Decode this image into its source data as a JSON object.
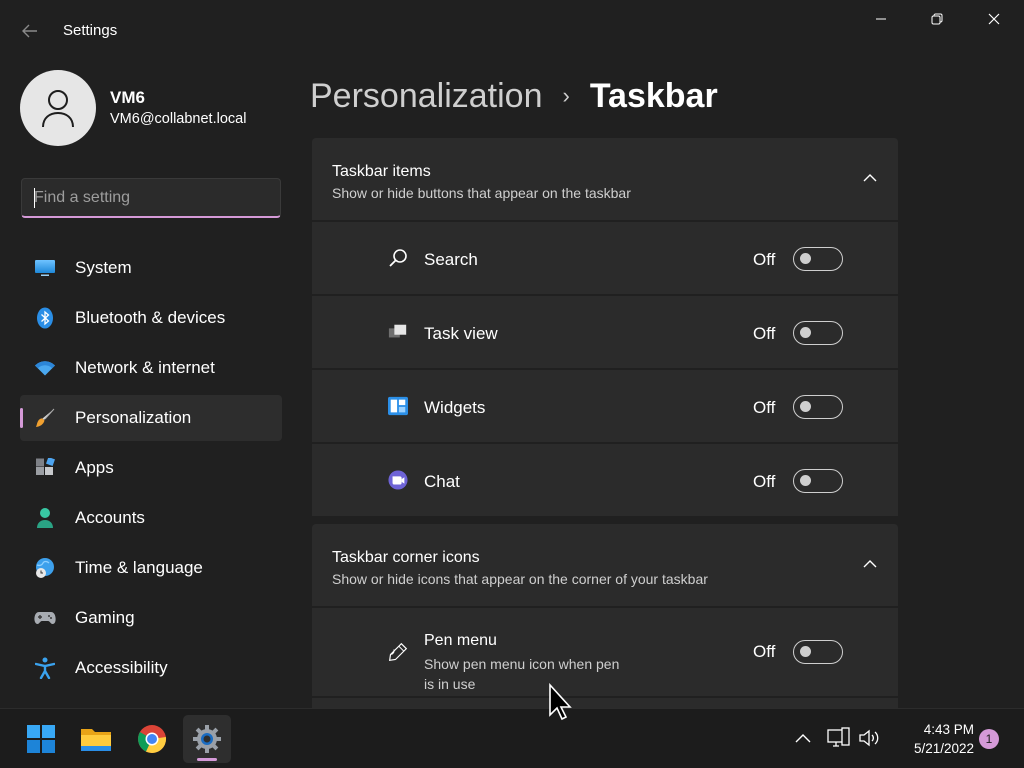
{
  "window": {
    "title": "Settings",
    "back_icon": "back-arrow-icon",
    "controls": [
      "minimize",
      "maximize",
      "close"
    ]
  },
  "user": {
    "name": "VM6",
    "email": "VM6@collabnet.local"
  },
  "search": {
    "placeholder": "Find a setting",
    "value": ""
  },
  "sidebar": {
    "items": [
      {
        "label": "System",
        "icon": "system-icon",
        "active": false
      },
      {
        "label": "Bluetooth & devices",
        "icon": "bluetooth-icon",
        "active": false
      },
      {
        "label": "Network & internet",
        "icon": "wifi-icon",
        "active": false
      },
      {
        "label": "Personalization",
        "icon": "paintbrush-icon",
        "active": true
      },
      {
        "label": "Apps",
        "icon": "apps-icon",
        "active": false
      },
      {
        "label": "Accounts",
        "icon": "accounts-icon",
        "active": false
      },
      {
        "label": "Time & language",
        "icon": "globe-clock-icon",
        "active": false
      },
      {
        "label": "Gaming",
        "icon": "gamepad-icon",
        "active": false
      },
      {
        "label": "Accessibility",
        "icon": "accessibility-icon",
        "active": false
      }
    ]
  },
  "breadcrumb": {
    "parent": "Personalization",
    "separator": "›",
    "current": "Taskbar"
  },
  "groups": [
    {
      "title": "Taskbar items",
      "subtitle": "Show or hide buttons that appear on the taskbar",
      "expanded": true,
      "items": [
        {
          "label": "Search",
          "icon": "search-icon",
          "status": "Off",
          "on": false
        },
        {
          "label": "Task view",
          "icon": "task-view-icon",
          "status": "Off",
          "on": false
        },
        {
          "label": "Widgets",
          "icon": "widgets-icon",
          "status": "Off",
          "on": false
        },
        {
          "label": "Chat",
          "icon": "chat-icon",
          "status": "Off",
          "on": false
        }
      ]
    },
    {
      "title": "Taskbar corner icons",
      "subtitle": "Show or hide icons that appear on the corner of your taskbar",
      "expanded": true,
      "items": [
        {
          "label": "Pen menu",
          "description": "Show pen menu icon when pen is in use",
          "icon": "pen-icon",
          "status": "Off",
          "on": false
        }
      ]
    }
  ],
  "taskbar": {
    "apps": [
      "start-icon",
      "file-explorer-icon",
      "chrome-icon",
      "settings-icon"
    ],
    "active_app": "settings-icon",
    "tray": [
      "chevron-up-icon",
      "network-icon",
      "volume-icon"
    ],
    "time": "4:43 PM",
    "date": "5/21/2022",
    "notification_count": "1"
  },
  "colors": {
    "background": "#202020",
    "card": "#2b2b2b",
    "accent": "#d59ad8",
    "taskbar": "#1c1c1c"
  }
}
